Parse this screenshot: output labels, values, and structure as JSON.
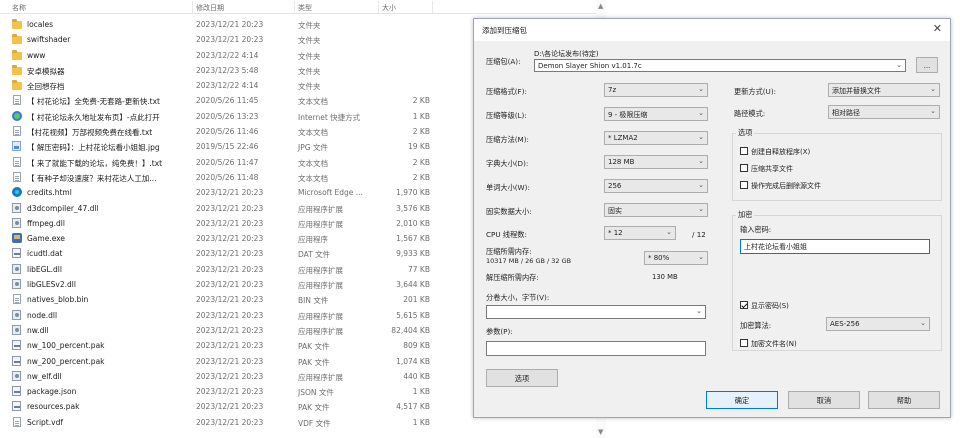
{
  "explorer": {
    "columns": {
      "name": "名称",
      "date": "修改日期",
      "type": "类型",
      "size": "大小"
    },
    "files": [
      {
        "icon": "folder-icon",
        "name": "locales",
        "date": "2023/12/21 20:23",
        "type": "文件夹",
        "size": ""
      },
      {
        "icon": "folder-icon",
        "name": "swiftshader",
        "date": "2023/12/21 20:23",
        "type": "文件夹",
        "size": ""
      },
      {
        "icon": "folder-icon",
        "name": "www",
        "date": "2023/12/22 4:14",
        "type": "文件夹",
        "size": ""
      },
      {
        "icon": "folder-icon",
        "name": "安卓模拟器",
        "date": "2023/12/23 5:48",
        "type": "文件夹",
        "size": ""
      },
      {
        "icon": "folder-icon",
        "name": "全回想存档",
        "date": "2023/12/22 4:14",
        "type": "文件夹",
        "size": ""
      },
      {
        "icon": "text-file-icon",
        "name": "【 村花论坛】全免费-无套路-更新快.txt",
        "date": "2020/5/26 11:45",
        "type": "文本文档",
        "size": "2 KB"
      },
      {
        "icon": "internet-shortcut-icon",
        "name": "【 村花论坛永久地址发布页】-点此打开",
        "date": "2020/5/26 13:23",
        "type": "Internet 快捷方式",
        "size": "1 KB"
      },
      {
        "icon": "text-file-icon",
        "name": "【村花视频】万部视频免费在线看.txt",
        "date": "2020/5/26 11:46",
        "type": "文本文档",
        "size": "2 KB"
      },
      {
        "icon": "image-file-icon",
        "name": "【 解压密码】：上村花论坛看小姐姐.jpg",
        "date": "2019/5/15 22:46",
        "type": "JPG 文件",
        "size": "19 KB"
      },
      {
        "icon": "text-file-icon",
        "name": "【 来了就能下载的论坛，纯免费！】.txt",
        "date": "2020/5/26 11:47",
        "type": "文本文档",
        "size": "2 KB"
      },
      {
        "icon": "text-file-icon",
        "name": "【 有种子却没速度？来村花达人工加...",
        "date": "2020/5/26 11:48",
        "type": "文本文档",
        "size": "2 KB"
      },
      {
        "icon": "edge-html-icon",
        "name": "credits.html",
        "date": "2023/12/21 20:23",
        "type": "Microsoft Edge ...",
        "size": "1,970 KB"
      },
      {
        "icon": "dll-file-icon",
        "name": "d3dcompiler_47.dll",
        "date": "2023/12/21 20:23",
        "type": "应用程序扩展",
        "size": "3,576 KB"
      },
      {
        "icon": "dll-file-icon",
        "name": "ffmpeg.dll",
        "date": "2023/12/21 20:23",
        "type": "应用程序扩展",
        "size": "2,010 KB"
      },
      {
        "icon": "exe-file-icon",
        "name": "Game.exe",
        "date": "2023/12/21 20:23",
        "type": "应用程序",
        "size": "1,567 KB"
      },
      {
        "icon": "pak-file-icon",
        "name": "icudtl.dat",
        "date": "2023/12/21 20:23",
        "type": "DAT 文件",
        "size": "9,933 KB"
      },
      {
        "icon": "dll-file-icon",
        "name": "libEGL.dll",
        "date": "2023/12/21 20:23",
        "type": "应用程序扩展",
        "size": "77 KB"
      },
      {
        "icon": "dll-file-icon",
        "name": "libGLESv2.dll",
        "date": "2023/12/21 20:23",
        "type": "应用程序扩展",
        "size": "3,644 KB"
      },
      {
        "icon": "text-file-icon",
        "name": "natives_blob.bin",
        "date": "2023/12/21 20:23",
        "type": "BIN 文件",
        "size": "201 KB"
      },
      {
        "icon": "dll-file-icon",
        "name": "node.dll",
        "date": "2023/12/21 20:23",
        "type": "应用程序扩展",
        "size": "5,615 KB"
      },
      {
        "icon": "dll-file-icon",
        "name": "nw.dll",
        "date": "2023/12/21 20:23",
        "type": "应用程序扩展",
        "size": "82,404 KB"
      },
      {
        "icon": "pak-file-icon",
        "name": "nw_100_percent.pak",
        "date": "2023/12/21 20:23",
        "type": "PAK 文件",
        "size": "809 KB"
      },
      {
        "icon": "pak-file-icon",
        "name": "nw_200_percent.pak",
        "date": "2023/12/21 20:23",
        "type": "PAK 文件",
        "size": "1,074 KB"
      },
      {
        "icon": "dll-file-icon",
        "name": "nw_elf.dll",
        "date": "2023/12/21 20:23",
        "type": "应用程序扩展",
        "size": "440 KB"
      },
      {
        "icon": "pak-file-icon",
        "name": "package.json",
        "date": "2023/12/21 20:23",
        "type": "JSON 文件",
        "size": "1 KB"
      },
      {
        "icon": "pak-file-icon",
        "name": "resources.pak",
        "date": "2023/12/21 20:23",
        "type": "PAK 文件",
        "size": "4,517 KB"
      },
      {
        "icon": "text-file-icon",
        "name": "Script.vdf",
        "date": "2023/12/21 20:23",
        "type": "VDF 文件",
        "size": "1 KB"
      }
    ]
  },
  "dialog": {
    "title": "添加到压缩包",
    "close_glyph": "✕",
    "archive": {
      "label": "压缩包(A):",
      "path": "D:\\各论坛发布(待定)",
      "filename": "Demon Slayer Shion v1.01.7c",
      "browse_label": "..."
    },
    "left": {
      "format_label": "压缩格式(F):",
      "format_value": "7z",
      "level_label": "压缩等级(L):",
      "level_value": "9 - 极限压缩",
      "method_label": "压缩方法(M):",
      "method_value": "* LZMA2",
      "dict_label": "字典大小(D):",
      "dict_value": "128 MB",
      "word_label": "单词大小(W):",
      "word_value": "256",
      "solid_label": "固实数据大小:",
      "solid_value": "固实",
      "cpu_label": "CPU 线程数:",
      "cpu_value": "* 12",
      "cpu_total": "/ 12",
      "mem_label": "压缩所需内存:",
      "mem_detail": "10317 MB / 26 GB / 32 GB",
      "mem_percent": "* 80%",
      "decomp_label": "解压缩所需内存:",
      "decomp_value": "130 MB",
      "split_label": "分卷大小，字节(V):",
      "split_value": "",
      "params_label": "参数(P):",
      "params_value": "",
      "options_button": "选项"
    },
    "right": {
      "update_label": "更新方式(U):",
      "update_value": "添加并替换文件",
      "pathmode_label": "路径模式:",
      "pathmode_value": "相对路径",
      "options_title": "选项",
      "opt_sfx": "创建自释放程序(X)",
      "opt_shared": "压缩共享文件",
      "opt_delete": "操作完成后删除源文件",
      "encrypt_title": "加密",
      "password_label": "输入密码:",
      "password_value": "上村花论坛看小姐姐",
      "show_password": "显示密码(S)",
      "enc_method_label": "加密算法:",
      "enc_method_value": "AES-256",
      "enc_names": "加密文件名(N)"
    },
    "buttons": {
      "ok": "确定",
      "cancel": "取消",
      "help": "帮助"
    }
  }
}
